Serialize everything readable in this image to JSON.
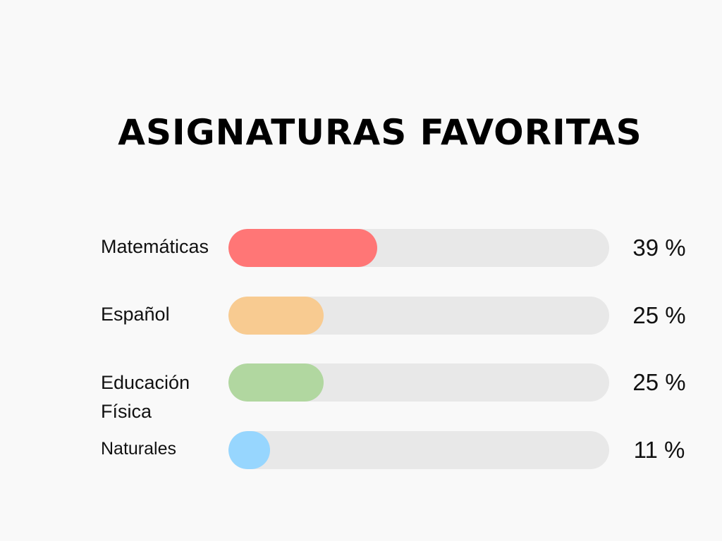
{
  "title": "ASIGNATURAS FAVORITAS",
  "chart_data": {
    "type": "bar",
    "orientation": "horizontal",
    "title": "ASIGNATURAS FAVORITAS",
    "categories": [
      "Matemáticas",
      "Español",
      "Educación Física",
      "Naturales"
    ],
    "values": [
      39,
      25,
      25,
      11
    ],
    "value_labels": [
      "39 %",
      "25 %",
      "25 %",
      "11 %"
    ],
    "unit": "%",
    "xlim": [
      0,
      100
    ],
    "grid": false,
    "colors": [
      "#ff7676",
      "#f8cb91",
      "#b1d7a0",
      "#97d6fe"
    ],
    "track_color": "#e8e8e8"
  }
}
